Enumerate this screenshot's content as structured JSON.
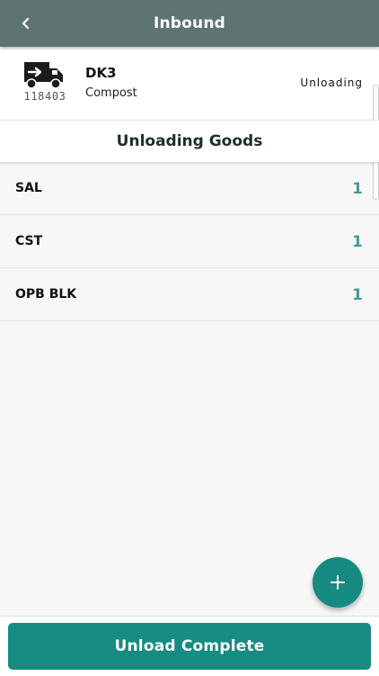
{
  "app_bar": {
    "title": "Inbound",
    "back_icon": "chevron-left-icon"
  },
  "vehicle": {
    "icon": "delivery-truck-icon",
    "id": "118403",
    "name": "DK3",
    "cargo": "Compost",
    "status": "Unloading"
  },
  "section": {
    "title": "Unloading Goods"
  },
  "goods": [
    {
      "name": "SAL",
      "qty": "1"
    },
    {
      "name": "CST",
      "qty": "1"
    },
    {
      "name": "OPB BLK",
      "qty": "1"
    }
  ],
  "fab": {
    "icon": "plus-icon"
  },
  "footer": {
    "button_label": "Unload Complete"
  },
  "colors": {
    "app_bar": "#5d7473",
    "accent": "#178c82",
    "quantity": "#3e9c95",
    "background": "#f7f7f7"
  }
}
